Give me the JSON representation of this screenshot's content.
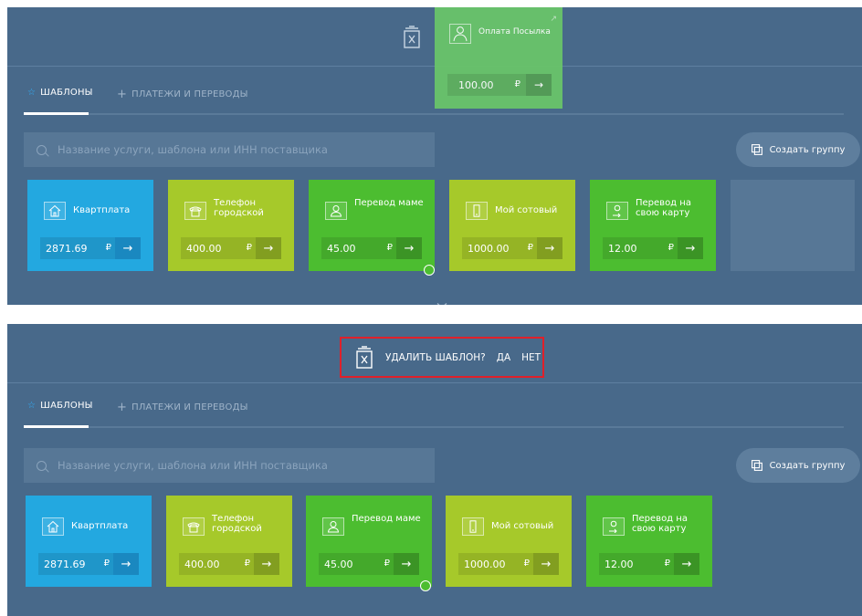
{
  "colors": {
    "panel_bg": "#48698a",
    "card_blue": "#23a8e0",
    "card_lime": "#a6c92a",
    "card_green": "#4cbd30",
    "highlight_border": "#e0202a"
  },
  "tabs": [
    {
      "label": "ШАБЛОНЫ",
      "icon": "star-icon",
      "active": true
    },
    {
      "label": "ПЛАТЕЖИ И ПЕРЕВОДЫ",
      "icon": "plus-icon",
      "active": false
    }
  ],
  "search": {
    "placeholder": "Название услуги, шаблона или ИНН поставщика"
  },
  "create_group": {
    "label": "Создать группу",
    "icon": "copy-icon"
  },
  "cards": [
    {
      "title": "Квартплата",
      "amount": "2871.69",
      "currency": "₽",
      "icon": "house-icon",
      "color": "blue"
    },
    {
      "title": "Телефон городской",
      "amount": "400.00",
      "currency": "₽",
      "icon": "phone-icon",
      "color": "lime"
    },
    {
      "title": "Перевод маме",
      "amount": "45.00",
      "currency": "₽",
      "icon": "person-icon",
      "color": "green"
    },
    {
      "title": "Мой сотовый",
      "amount": "1000.00",
      "currency": "₽",
      "icon": "mobile-icon",
      "color": "lime"
    },
    {
      "title": "Перевод на свою карту",
      "amount": "12.00",
      "currency": "₽",
      "icon": "transfer-icon",
      "color": "green"
    }
  ],
  "dragged_card": {
    "title": "Оплата Посылка",
    "amount": "100.00",
    "currency": "₽",
    "icon": "person-icon"
  },
  "confirm_dialog": {
    "question": "УДАЛИТЬ ШАБЛОН?",
    "yes": "ДА",
    "no": "НЕТ"
  },
  "icons": {
    "trash": "trash-icon",
    "expand": "chevron-down-icon",
    "chat": "chat-bubble-icon"
  }
}
